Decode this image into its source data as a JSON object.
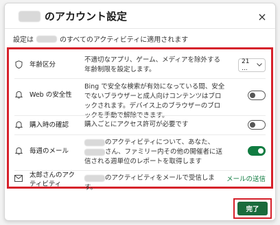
{
  "dialog": {
    "title": "のアカウント設定",
    "subtitle_prefix": "設定は",
    "subtitle_suffix": "のすべてのアクティビティに適用されます",
    "close_icon": "×"
  },
  "rows": [
    {
      "label": "年齢区分",
      "desc": "不適切なアプリ、ゲーム、メディアを除外する年齢制限を設定します。",
      "control_type": "select",
      "select_value": "21 ...",
      "icon": "shield-icon"
    },
    {
      "label": "Web の安全性",
      "desc": "Bing で安全な検索が有効になっている間、安全でないブラウザーと成人向けコンテンツはブロックされます。デバイス上のブラウザーのブロックを手動で解除できます。",
      "control_type": "toggle",
      "toggle_on": false,
      "icon": "bell-icon"
    },
    {
      "label": "購入時の確認",
      "desc": "購入ごとにアクセス許可が必要です",
      "control_type": "toggle",
      "toggle_on": false,
      "icon": "bell-icon"
    },
    {
      "label": "毎週のメール",
      "desc_a": "のアクティビティについて、あなた、",
      "desc_b": "さん、ファミリー内その他の開催者に送信される週単位のレポートを取得します",
      "control_type": "toggle",
      "toggle_on": true,
      "icon": "bell-icon"
    },
    {
      "label": "太郎さんのアクティビティ",
      "desc": "のアクティビティをメールで受信します。",
      "control_type": "link",
      "link_text": "メールの送信",
      "icon": "mail-icon"
    }
  ],
  "footer": {
    "done_label": "完了"
  },
  "colors": {
    "accent": "#107c41",
    "highlight": "#d6202a"
  }
}
